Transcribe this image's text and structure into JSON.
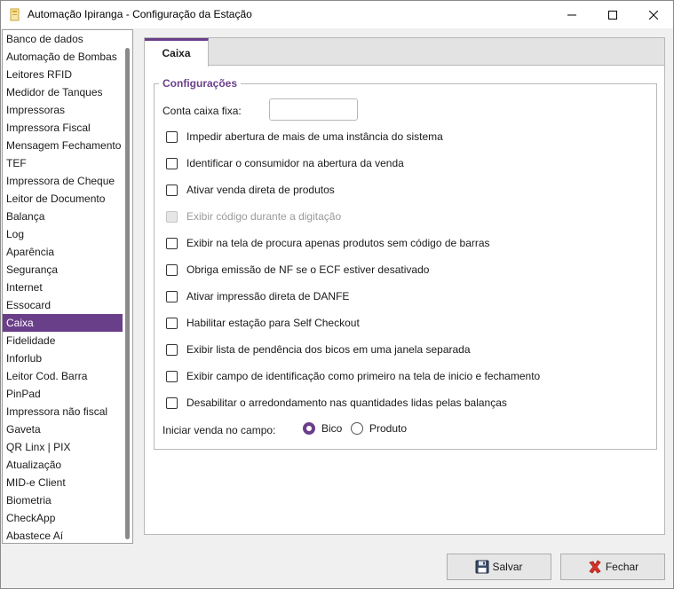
{
  "window": {
    "title": "Automação Ipiranga - Configuração da Estação"
  },
  "sidebar": {
    "items": [
      {
        "label": "Banco de dados"
      },
      {
        "label": "Automação de Bombas"
      },
      {
        "label": "Leitores RFID"
      },
      {
        "label": "Medidor de Tanques"
      },
      {
        "label": "Impressoras"
      },
      {
        "label": "Impressora Fiscal"
      },
      {
        "label": "Mensagem Fechamento"
      },
      {
        "label": "TEF"
      },
      {
        "label": "Impressora de Cheque"
      },
      {
        "label": "Leitor de Documento"
      },
      {
        "label": "Balança"
      },
      {
        "label": "Log"
      },
      {
        "label": "Aparência"
      },
      {
        "label": "Segurança"
      },
      {
        "label": "Internet"
      },
      {
        "label": "Essocard"
      },
      {
        "label": "Caixa",
        "selected": true
      },
      {
        "label": "Fidelidade"
      },
      {
        "label": "Inforlub"
      },
      {
        "label": "Leitor Cod. Barra"
      },
      {
        "label": "PinPad"
      },
      {
        "label": "Impressora não fiscal"
      },
      {
        "label": "Gaveta"
      },
      {
        "label": "QR Linx | PIX"
      },
      {
        "label": "Atualização"
      },
      {
        "label": "MID-e Client"
      },
      {
        "label": "Biometria"
      },
      {
        "label": "CheckApp"
      },
      {
        "label": "Abastece Aí"
      }
    ]
  },
  "main": {
    "tab_label": "Caixa",
    "group_label": "Configurações",
    "conta_caixa_label": "Conta caixa fixa:",
    "conta_caixa_value": "",
    "checkboxes": [
      {
        "label": "Impedir abertura de mais de uma instância do sistema",
        "checked": false,
        "disabled": false
      },
      {
        "label": "Identificar o consumidor na abertura da venda",
        "checked": false,
        "disabled": false
      },
      {
        "label": "Ativar venda direta de produtos",
        "checked": false,
        "disabled": false
      },
      {
        "label": "Exibir código durante a digitação",
        "checked": false,
        "disabled": true
      },
      {
        "label": "Exibir na tela de procura apenas produtos sem código de barras",
        "checked": false,
        "disabled": false
      },
      {
        "label": "Obriga emissão de NF se o ECF estiver desativado",
        "checked": false,
        "disabled": false
      },
      {
        "label": "Ativar impressão direta de DANFE",
        "checked": false,
        "disabled": false
      },
      {
        "label": "Habilitar estação para Self Checkout",
        "checked": false,
        "disabled": false
      },
      {
        "label": "Exibir lista de pendência dos bicos em uma janela separada",
        "checked": false,
        "disabled": false
      },
      {
        "label": "Exibir campo de identificação como primeiro na tela de inicio e fechamento",
        "checked": false,
        "disabled": false
      },
      {
        "label": "Desabilitar o arredondamento nas quantidades lidas pelas balanças",
        "checked": false,
        "disabled": false
      }
    ],
    "iniciar_venda_label": "Iniciar venda no campo:",
    "radio_options": [
      {
        "label": "Bico",
        "checked": true
      },
      {
        "label": "Produto",
        "checked": false
      }
    ]
  },
  "footer": {
    "save_label": "Salvar",
    "close_label": "Fechar"
  },
  "colors": {
    "accent": "#6a3f8a",
    "close_icon_red": "#d9342b"
  },
  "icons": {
    "app": "app-icon",
    "minimize": "minimize-icon",
    "maximize": "maximize-icon",
    "close": "close-icon",
    "save": "floppy-disk-icon",
    "cancel": "red-x-icon"
  }
}
